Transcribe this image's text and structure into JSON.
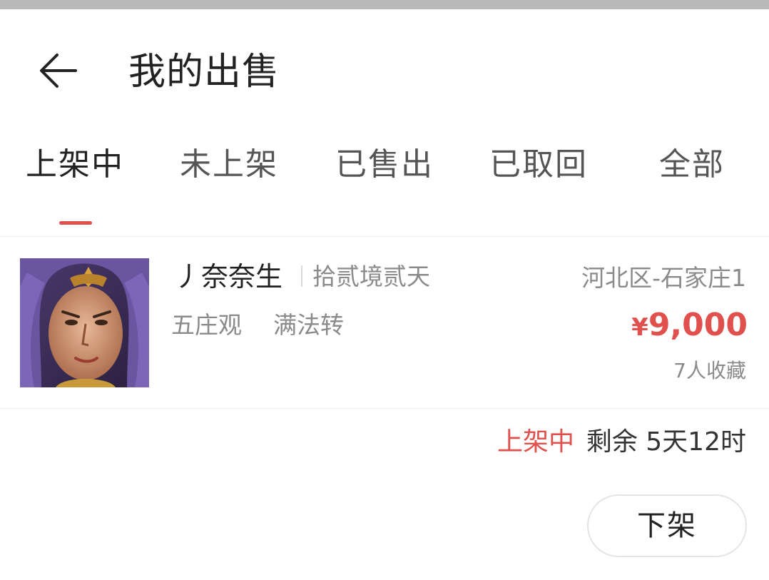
{
  "header": {
    "back_icon": "arrow-left-icon",
    "title": "我的出售"
  },
  "tabs": [
    {
      "label": "上架中",
      "active": true
    },
    {
      "label": "未上架",
      "active": false
    },
    {
      "label": "已售出",
      "active": false
    },
    {
      "label": "已取回",
      "active": false
    },
    {
      "label": "全部",
      "active": false
    }
  ],
  "listing": {
    "avatar_icon": "character-portrait",
    "seller_name": "丿奈奈生",
    "server": "拾贰境贰天",
    "faction": "五庄观",
    "level": "满法转",
    "region": "河北区-石家庄1",
    "price_symbol": "¥",
    "price": "9,000",
    "favorites": "7人收藏"
  },
  "status": {
    "label": "上架中",
    "remaining": "剩余 5天12时"
  },
  "actions": {
    "delist_label": "下架"
  },
  "colors": {
    "accent": "#e0504c",
    "text_primary": "#222222",
    "text_secondary": "#8a8a8a",
    "divider": "#ededed"
  }
}
